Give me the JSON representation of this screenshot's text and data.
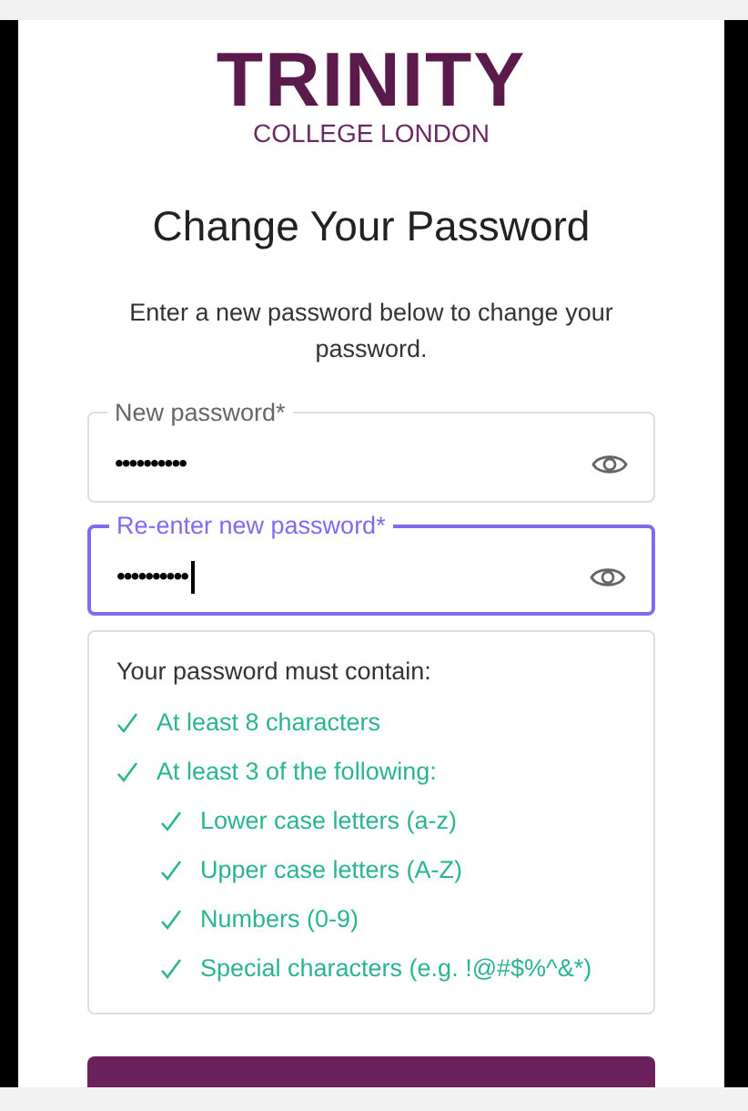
{
  "logo": {
    "title": "TRINITY",
    "subtitle": "COLLEGE LONDON"
  },
  "heading": "Change Your Password",
  "intro": "Enter a new password below to change your password.",
  "fields": [
    {
      "label": "New password*",
      "value": "••••••••••",
      "focused": false
    },
    {
      "label": "Re-enter new password*",
      "value": "••••••••••",
      "focused": true
    }
  ],
  "requirements": {
    "title": "Your password must contain:",
    "items": [
      {
        "text": "At least 8 characters",
        "met": true
      },
      {
        "text": "At least 3 of the following:",
        "met": true,
        "children": [
          {
            "text": "Lower case letters (a-z)",
            "met": true
          },
          {
            "text": "Upper case letters (A-Z)",
            "met": true
          },
          {
            "text": "Numbers (0-9)",
            "met": true
          },
          {
            "text": "Special characters (e.g. !@#$%^&*)",
            "met": true
          }
        ]
      }
    ]
  }
}
